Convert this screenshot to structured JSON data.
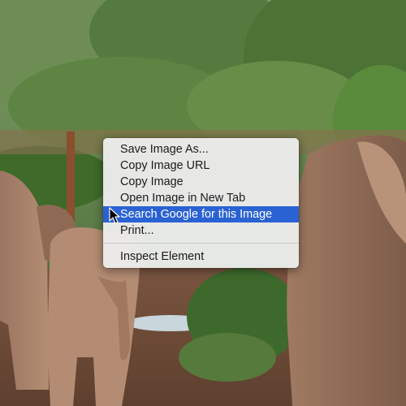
{
  "background": {
    "description_icon": "elephant-photo"
  },
  "context_menu": {
    "items": [
      {
        "label": "Save Image As..."
      },
      {
        "label": "Copy Image URL"
      },
      {
        "label": "Copy Image"
      },
      {
        "label": "Open Image in New Tab"
      },
      {
        "label": "Search Google for this Image",
        "highlighted": true
      },
      {
        "label": "Print..."
      },
      {
        "label": "Inspect Element"
      }
    ],
    "highlight_color": "#2a62d4"
  },
  "cursor": {
    "icon": "arrow-cursor-icon"
  }
}
